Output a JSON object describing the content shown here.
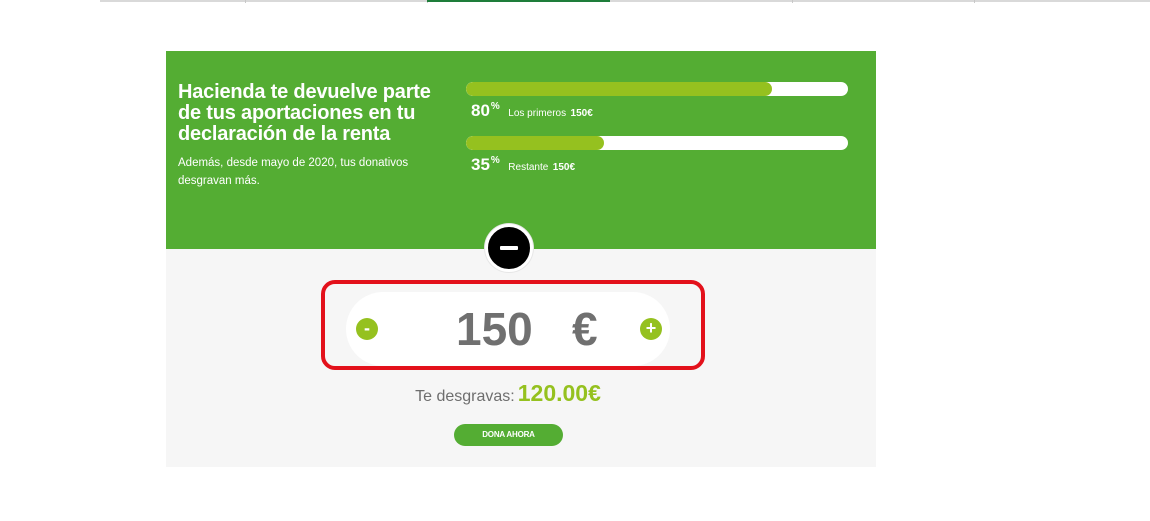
{
  "banner": {
    "title": "Hacienda te devuelve parte de tus aportaciones en tu declaración de la renta",
    "subtitle": "Además, desde mayo de 2020, tus donativos desgravan más.",
    "tiers": [
      {
        "percent": "80",
        "symbol": "%",
        "label": "Los primeros",
        "amount": "150€",
        "fill": 0.8
      },
      {
        "percent": "35",
        "symbol": "%",
        "label": "Restante",
        "amount": "150€",
        "fill": 0.36
      }
    ]
  },
  "collapse_icon": "minus-icon",
  "donation": {
    "decrement": "-",
    "increment": "+",
    "value": "150",
    "currency": "€"
  },
  "saving": {
    "label": "Te desgravas:",
    "value": "120.00€"
  },
  "donate_button": "DONA AHORA",
  "colors": {
    "banner_green": "#54ad33",
    "accent_lime": "#95c11f",
    "highlight_red": "#e3111b",
    "nav_active": "#1e7d3a"
  }
}
